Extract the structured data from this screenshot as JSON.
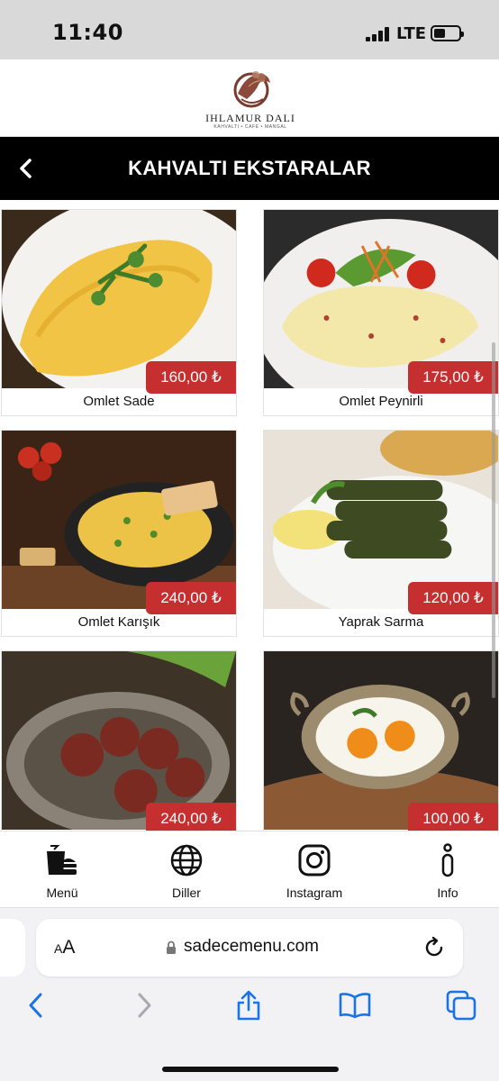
{
  "status_bar": {
    "time": "11:40",
    "network": "LTE",
    "battery_level": 0.45
  },
  "header": {
    "logo_name": "IHLAMUR DALI",
    "logo_tagline": "KAHVALTI • CAFE • MANGAL"
  },
  "title_bar": {
    "title": "KAHVALTI EKSTARALAR",
    "back_icon": "chevron-left-icon"
  },
  "products": [
    {
      "name": "Omlet Sade",
      "price": "160,00 ₺"
    },
    {
      "name": "Omlet Peynirli",
      "price": "175,00 ₺"
    },
    {
      "name": "Omlet Karışık",
      "price": "240,00 ₺"
    },
    {
      "name": "Yaprak Sarma",
      "price": "120,00 ₺"
    },
    {
      "name": "",
      "price": "240,00 ₺"
    },
    {
      "name": "",
      "price": "100,00 ₺"
    }
  ],
  "bottom_nav": [
    {
      "label": "Menü",
      "icon": "burger-drink-icon"
    },
    {
      "label": "Diller",
      "icon": "globe-icon"
    },
    {
      "label": "Instagram",
      "icon": "instagram-icon"
    },
    {
      "label": "Info",
      "icon": "info-icon"
    }
  ],
  "browser": {
    "text_size_label": "AA",
    "url": "sadecemenu.com",
    "toolbar": [
      "back-icon",
      "forward-icon",
      "share-icon",
      "bookmarks-icon",
      "tabs-icon"
    ]
  },
  "colors": {
    "price_badge": "#c62f2f",
    "title_bar": "#000000",
    "ios_blue": "#1a73e8"
  }
}
